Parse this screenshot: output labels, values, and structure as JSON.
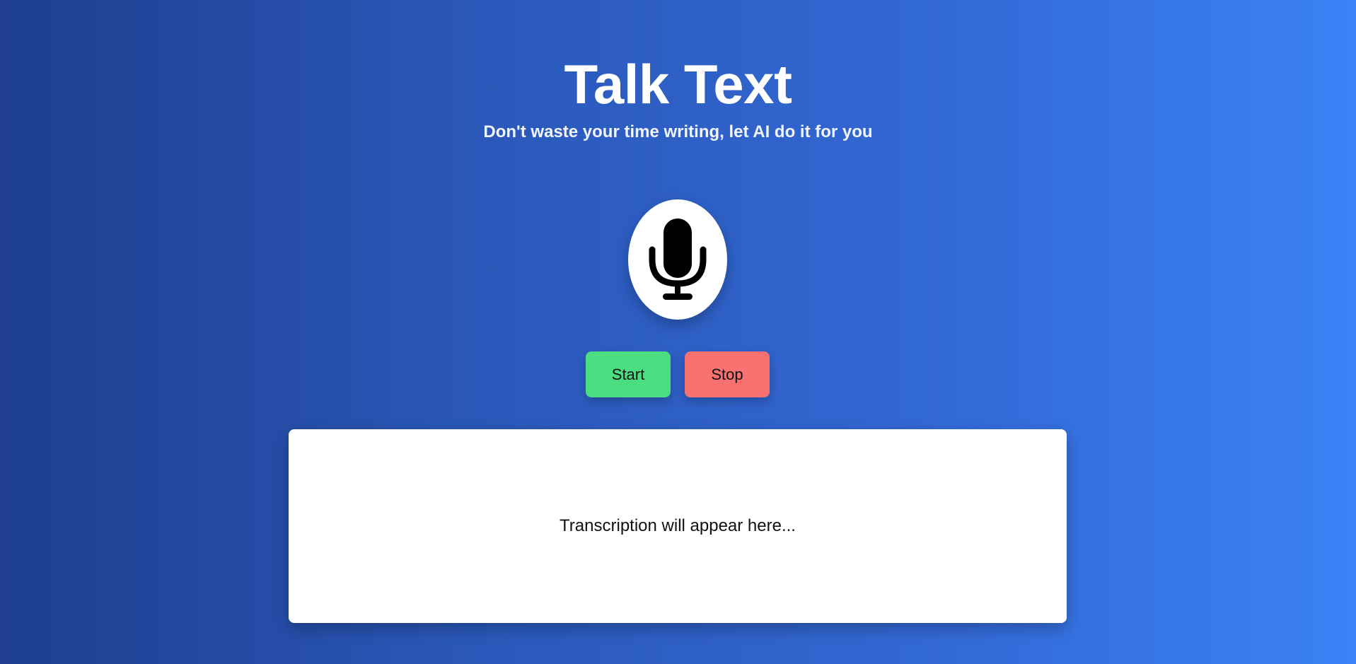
{
  "header": {
    "title": "Talk Text",
    "subtitle": "Don't waste your time writing, let AI do it for you"
  },
  "mic": {
    "icon": "microphone-icon"
  },
  "controls": {
    "start_label": "Start",
    "stop_label": "Stop",
    "start_color": "#4ade80",
    "stop_color": "#f87171"
  },
  "transcript": {
    "placeholder": "Transcription will appear here..."
  },
  "theme": {
    "background_start": "#1f3e8f",
    "background_end": "#3b82f6"
  }
}
